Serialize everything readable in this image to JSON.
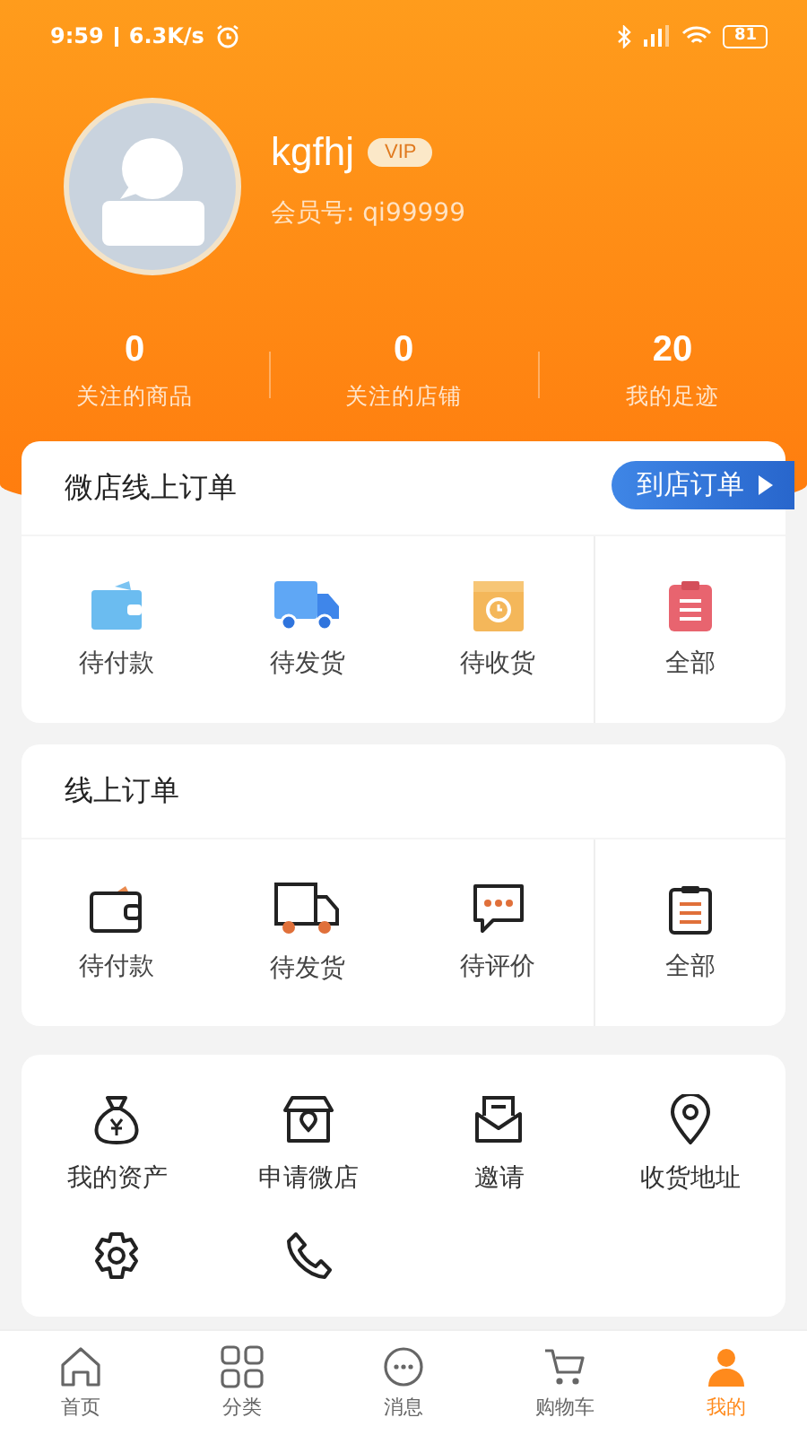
{
  "status_bar": {
    "time": "9:59",
    "speed": "6.3K/s",
    "battery": "81"
  },
  "profile": {
    "username": "kgfhj",
    "badge": "VIP",
    "member_id": "会员号: qi99999"
  },
  "stats": [
    {
      "value": "0",
      "label": "关注的商品"
    },
    {
      "value": "0",
      "label": "关注的店铺"
    },
    {
      "value": "20",
      "label": "我的足迹"
    }
  ],
  "shop_orders": {
    "title": "微店线上订单",
    "button": "到店订单",
    "items": [
      {
        "label": "待付款",
        "kind": "wallet"
      },
      {
        "label": "待发货",
        "kind": "truck"
      },
      {
        "label": "待收货",
        "kind": "box"
      },
      {
        "label": "全部",
        "kind": "clipboard"
      }
    ]
  },
  "online_orders": {
    "title": "线上订单",
    "items": [
      {
        "label": "待付款",
        "kind": "wallet"
      },
      {
        "label": "待发货",
        "kind": "truck"
      },
      {
        "label": "待评价",
        "kind": "chat"
      },
      {
        "label": "全部",
        "kind": "clipboard"
      }
    ]
  },
  "services": [
    {
      "label": "我的资产",
      "kind": "moneybag"
    },
    {
      "label": "申请微店",
      "kind": "shop"
    },
    {
      "label": "邀请",
      "kind": "envelope"
    },
    {
      "label": "收货地址",
      "kind": "pin"
    },
    {
      "kind": "gear"
    },
    {
      "kind": "phone"
    }
  ],
  "tab_bar": [
    {
      "label": "首页",
      "kind": "home",
      "selected": false
    },
    {
      "label": "分类",
      "kind": "grid",
      "selected": false
    },
    {
      "label": "消息",
      "kind": "chat",
      "selected": false
    },
    {
      "label": "购物车",
      "kind": "cart",
      "selected": false
    },
    {
      "label": "我的",
      "kind": "user",
      "selected": true
    }
  ]
}
